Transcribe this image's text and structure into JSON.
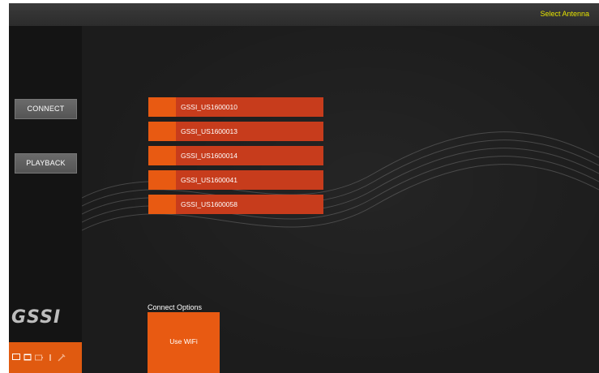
{
  "header": {
    "title": "Select Antenna"
  },
  "sidebar": {
    "buttons": [
      {
        "label": "CONNECT"
      },
      {
        "label": "PLAYBACK"
      }
    ],
    "logo_text": "GSSI",
    "status_icons": [
      "monitor-icon",
      "window-icon",
      "battery-icon",
      "info-icon",
      "tool-icon"
    ]
  },
  "antennas": [
    {
      "label": "GSSI_US1600010"
    },
    {
      "label": "GSSI_US1600013"
    },
    {
      "label": "GSSI_US1600014"
    },
    {
      "label": "GSSI_US1600041"
    },
    {
      "label": "GSSI_US1600058"
    }
  ],
  "connect_options": {
    "title": "Connect Options",
    "tile_label": "Use WiFi"
  },
  "colors": {
    "accent_orange": "#e85a12",
    "antenna_red": "#c73c1c",
    "title_yellow": "#e6e400"
  }
}
